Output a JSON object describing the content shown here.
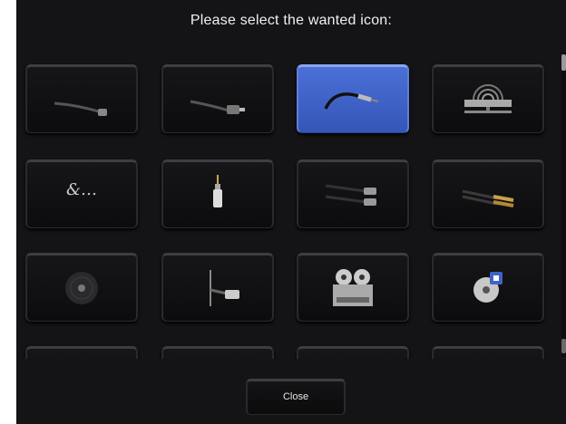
{
  "dialog": {
    "title": "Please select the wanted icon:",
    "close_label": "Close",
    "selected_icon": "coax-cable-icon",
    "accent_color": "#3f63c8"
  },
  "icons": [
    "xlr-cable-icon",
    "rca-plug-icon",
    "coax-cable-icon",
    "speaker-wall-icon",
    "ellipsis-icon",
    "jack-plug-icon",
    "dual-xlr-cable-icon",
    "stereo-rca-cable-icon",
    "vinyl-record-icon",
    "ethernet-cable-icon",
    "reel-to-reel-tape-icon",
    "cd-stack-icon"
  ],
  "ellipsis_tile": {
    "text": "&…"
  }
}
